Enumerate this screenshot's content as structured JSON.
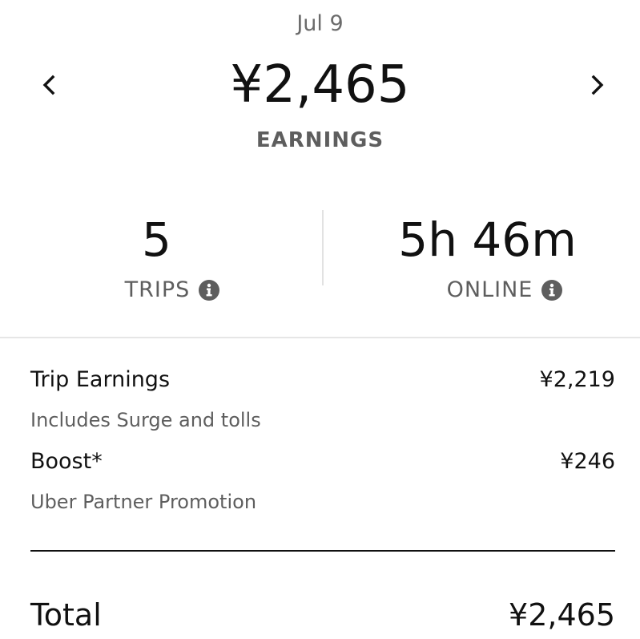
{
  "header": {
    "date": "Jul 9",
    "amount": "¥2,465",
    "label": "EARNINGS",
    "prev_icon": "chevron-left-icon",
    "next_icon": "chevron-right-icon"
  },
  "stats": {
    "trips": {
      "value": "5",
      "label": "TRIPS",
      "icon": "info-icon"
    },
    "online": {
      "value": "5h 46m",
      "label": "ONLINE",
      "icon": "info-icon"
    }
  },
  "breakdown": [
    {
      "label": "Trip Earnings",
      "value": "¥2,219",
      "note": "Includes Surge and tolls"
    },
    {
      "label": "Boost*",
      "value": "¥246",
      "note": "Uber Partner Promotion"
    }
  ],
  "total": {
    "label": "Total",
    "value": "¥2,465"
  },
  "colors": {
    "text_primary": "#111111",
    "text_secondary": "#5e5e5e",
    "icon_fill": "#5e5e5e",
    "divider": "#e2e2e2"
  }
}
